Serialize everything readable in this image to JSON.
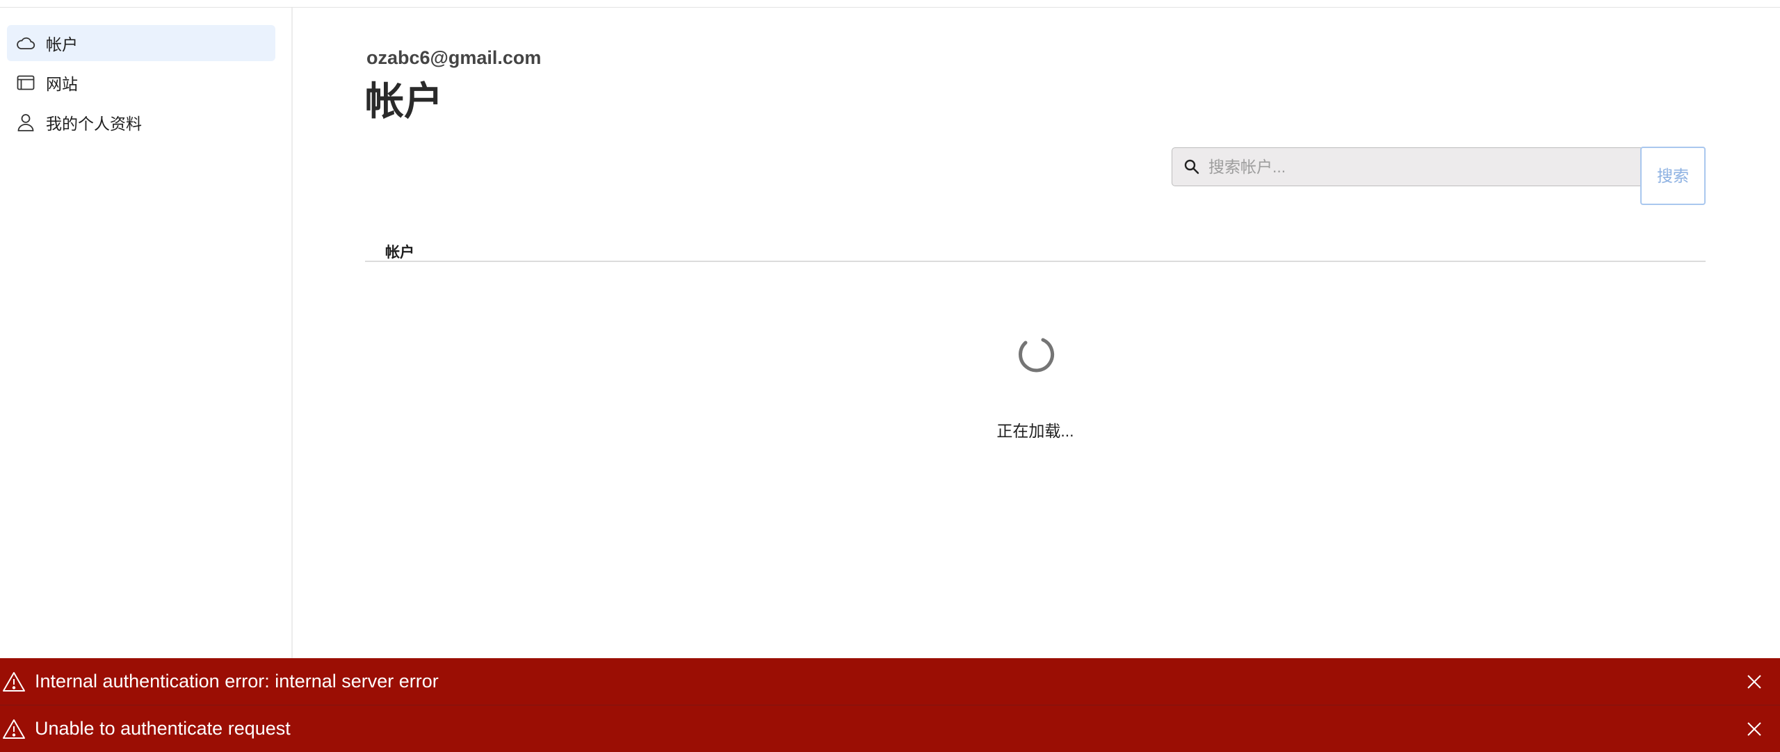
{
  "sidebar": {
    "items": [
      {
        "label": "帐户",
        "icon": "cloud-icon",
        "active": true
      },
      {
        "label": "网站",
        "icon": "browser-window-icon",
        "active": false
      },
      {
        "label": "我的个人资料",
        "icon": "user-icon",
        "active": false
      }
    ]
  },
  "header": {
    "email": "ozabc6@gmail.com",
    "title": "帐户"
  },
  "search": {
    "placeholder": "搜索帐户...",
    "value": "",
    "button_label": "搜索",
    "icon": "search-icon"
  },
  "table": {
    "columns": [
      "帐户"
    ]
  },
  "loading": {
    "text": "正在加载..."
  },
  "alerts": [
    {
      "message": "Internal authentication error: internal server error",
      "icon": "warning-icon"
    },
    {
      "message": "Unable to authenticate request",
      "icon": "warning-icon"
    }
  ],
  "colors": {
    "alert_bg": "#9b0e04",
    "active_nav_bg": "#eaf2fd",
    "search_button_text": "#8db1e2"
  }
}
